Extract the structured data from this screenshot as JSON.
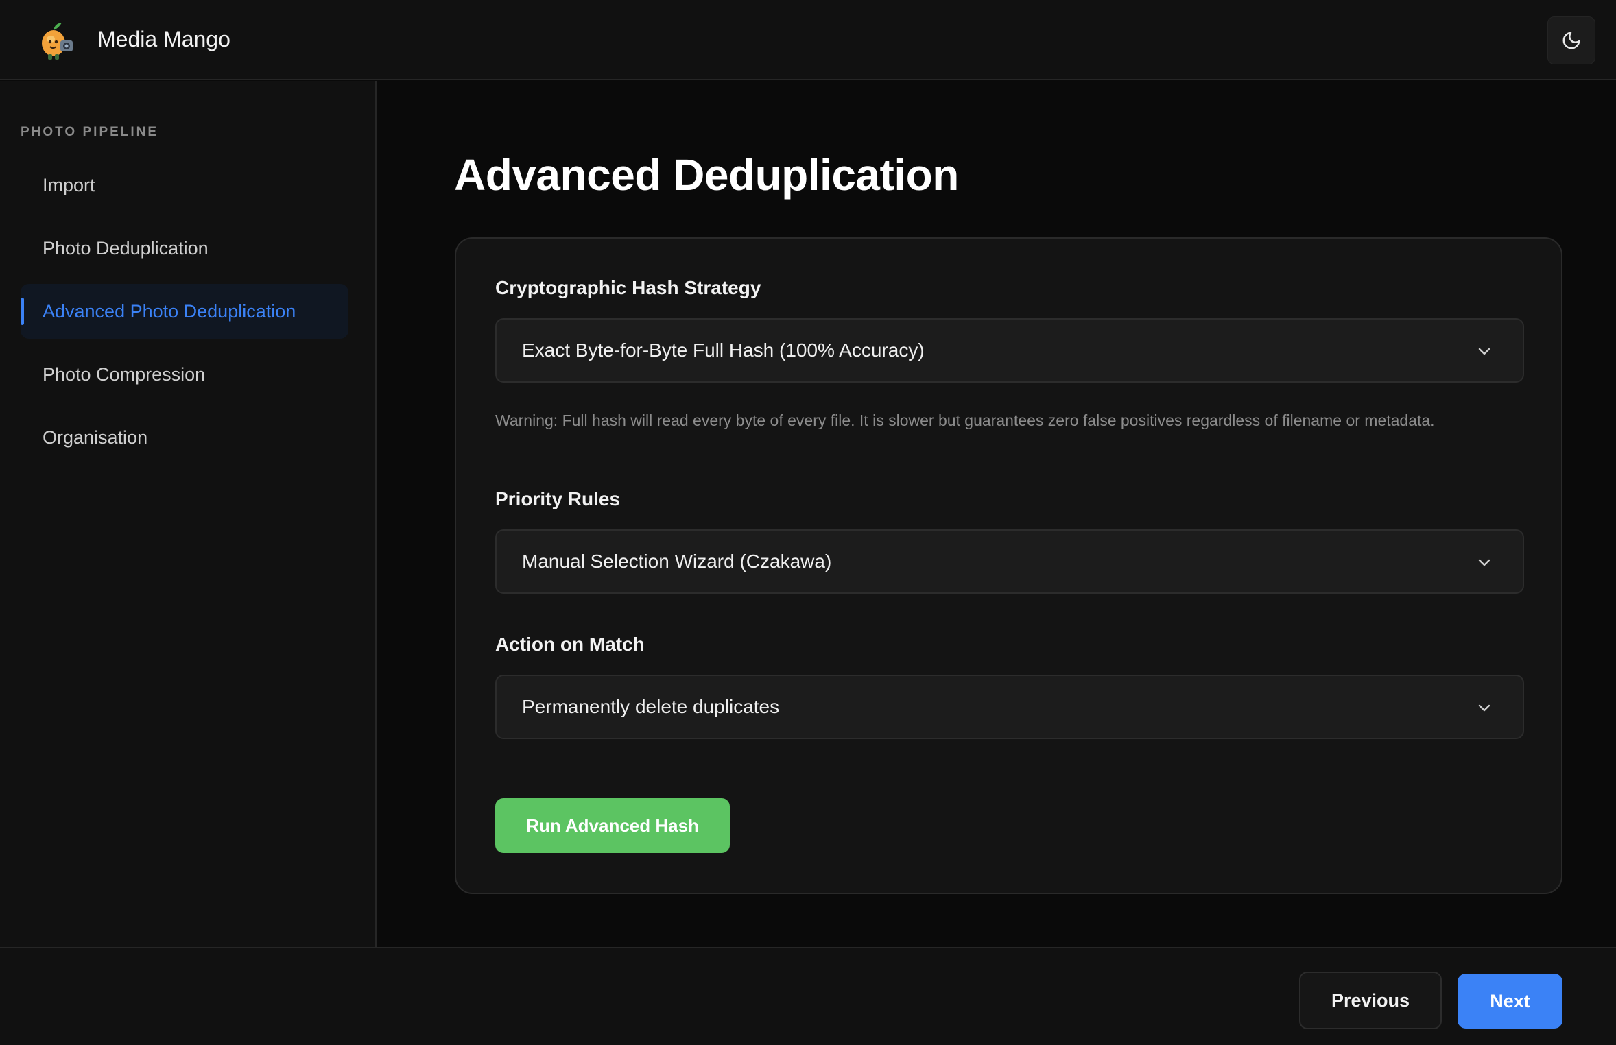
{
  "header": {
    "app_title": "Media Mango",
    "logo_icon": "mango-mascot-icon",
    "theme_toggle_icon": "moon-icon"
  },
  "sidebar": {
    "heading": "PHOTO PIPELINE",
    "items": [
      {
        "label": "Import",
        "active": false
      },
      {
        "label": "Photo Deduplication",
        "active": false
      },
      {
        "label": "Advanced Photo Deduplication",
        "active": true
      },
      {
        "label": "Photo Compression",
        "active": false
      },
      {
        "label": "Organisation",
        "active": false
      }
    ]
  },
  "main": {
    "title": "Advanced Deduplication",
    "hash_strategy": {
      "label": "Cryptographic Hash Strategy",
      "value": "Exact Byte-for-Byte Full Hash (100% Accuracy)",
      "warning": "Warning: Full hash will read every byte of every file. It is slower but guarantees zero false positives regardless of filename or metadata."
    },
    "priority_rules": {
      "label": "Priority Rules",
      "value": "Manual Selection Wizard (Czakawa)"
    },
    "action_on_match": {
      "label": "Action on Match",
      "value": "Permanently delete duplicates"
    },
    "run_button_label": "Run Advanced Hash"
  },
  "footer": {
    "previous_label": "Previous",
    "next_label": "Next"
  },
  "colors": {
    "accent_blue": "#3b82f6",
    "success_green": "#5cc462",
    "background": "#0a0a0a",
    "panel": "#111111"
  }
}
